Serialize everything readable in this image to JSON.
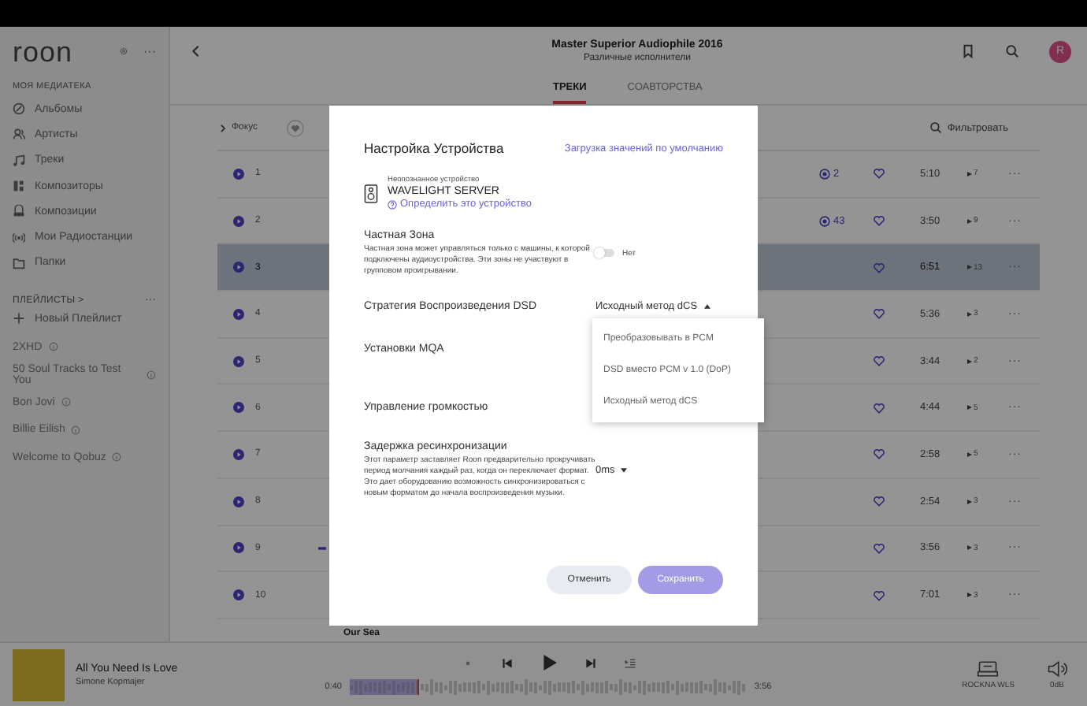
{
  "sidebar": {
    "logo": "roon",
    "more": "···",
    "library_heading": "МОЯ МЕДИАТЕКА",
    "library_items": [
      {
        "label": "Альбомы",
        "kind": "albums"
      },
      {
        "label": "Артисты",
        "kind": "artists"
      },
      {
        "label": "Треки",
        "kind": "tracks"
      },
      {
        "label": "Композиторы",
        "kind": "composers"
      },
      {
        "label": "Композиции",
        "kind": "compositions"
      },
      {
        "label": "Мои Радиостанции",
        "kind": "radio"
      },
      {
        "label": "Папки",
        "kind": "folders"
      }
    ],
    "playlists_heading": "ПЛЕЙЛИСТЫ >",
    "playlists_more": "···",
    "new_playlist": "Новый Плейлист",
    "playlists": [
      "2XHD",
      "50 Soul Tracks to Test You",
      "Bon Jovi",
      "Billie Eilish",
      "Welcome to Qobuz"
    ]
  },
  "header": {
    "title": "Master Superior Audiophile 2016",
    "subtitle": "Различные исполнители",
    "avatar": "R",
    "tabs": [
      {
        "label": "ТРЕКИ",
        "selected": true
      },
      {
        "label": "СОАВТОРСТВА",
        "selected": false
      }
    ]
  },
  "toolbar": {
    "focus": "Фокус",
    "filter": "Фильтровать"
  },
  "tracks": [
    {
      "number": "1",
      "radio_count": "2",
      "duration": "5:10",
      "plays": "7",
      "more": "···",
      "selected": false,
      "marker": false
    },
    {
      "number": "2",
      "radio_count": "43",
      "duration": "3:50",
      "plays": "9",
      "more": "···",
      "selected": false,
      "marker": false
    },
    {
      "number": "3",
      "duration": "6:51",
      "plays": "13",
      "more": "···",
      "selected": true,
      "marker": false
    },
    {
      "number": "4",
      "duration": "5:36",
      "plays": "3",
      "more": "···",
      "selected": false,
      "marker": false
    },
    {
      "number": "5",
      "duration": "3:44",
      "plays": "2",
      "more": "···",
      "selected": false,
      "marker": false
    },
    {
      "number": "6",
      "duration": "4:44",
      "plays": "5",
      "more": "···",
      "selected": false,
      "marker": false
    },
    {
      "number": "7",
      "duration": "2:58",
      "plays": "5",
      "more": "···",
      "selected": false,
      "marker": false
    },
    {
      "number": "8",
      "duration": "2:54",
      "plays": "3",
      "more": "···",
      "selected": false,
      "marker": false
    },
    {
      "number": "9",
      "duration": "3:56",
      "plays": "3",
      "more": "···",
      "selected": false,
      "marker": true
    },
    {
      "number": "10",
      "duration": "7:01",
      "plays": "3",
      "more": "···",
      "selected": false,
      "marker": false
    }
  ],
  "next_section": "Our Sea",
  "dialog": {
    "title": "Настройка Устройства",
    "defaults_link": "Загрузка значений по умолчанию",
    "device": {
      "caption": "Неопознанное устройство",
      "name": "WAVELIGHT SERVER",
      "identify_link": "Определить это устройство"
    },
    "settings": [
      {
        "kind": "toggle",
        "label": "Частная Зона",
        "description": "Частная зона может управляться только с машины, к которой подключены аудиоустройства. Эти зоны не участвуют в групповом проигрывании.",
        "on": false,
        "value": "Нет"
      },
      {
        "kind": "select",
        "label": "Стратегия Воспроизведения DSD",
        "value": "Исходный метод dCS",
        "expanded": true,
        "options": [
          "Преобразовывать в PCM",
          "DSD вместо PCM v 1.0 (DoP)",
          "Исходный метод dCS"
        ]
      },
      {
        "kind": "plain",
        "label": "Установки MQA"
      },
      {
        "kind": "plain",
        "label": "Управление громкостью"
      },
      {
        "kind": "select",
        "label": "Задержка ресинхронизации",
        "description": "Этот параметр заставляет Roon предварительно прокручивать период молчания каждый раз, когда он переключает формат. Это дает оборудованию возможность синхронизироваться с новым форматом до начала воспроизведения музыки.",
        "value": "0ms",
        "expanded": false
      }
    ],
    "buttons": [
      {
        "label": "Отменить",
        "kind": "cancel",
        "disabled": false
      },
      {
        "label": "Сохранить",
        "kind": "save",
        "disabled": true
      }
    ]
  },
  "player": {
    "title": "All You Need Is Love",
    "artist": "Simone Kopmajer",
    "elapsed": "0:40",
    "total": "3:56",
    "level": 0.17,
    "zone": "ROCKNA WLS",
    "volume": "0dB"
  }
}
